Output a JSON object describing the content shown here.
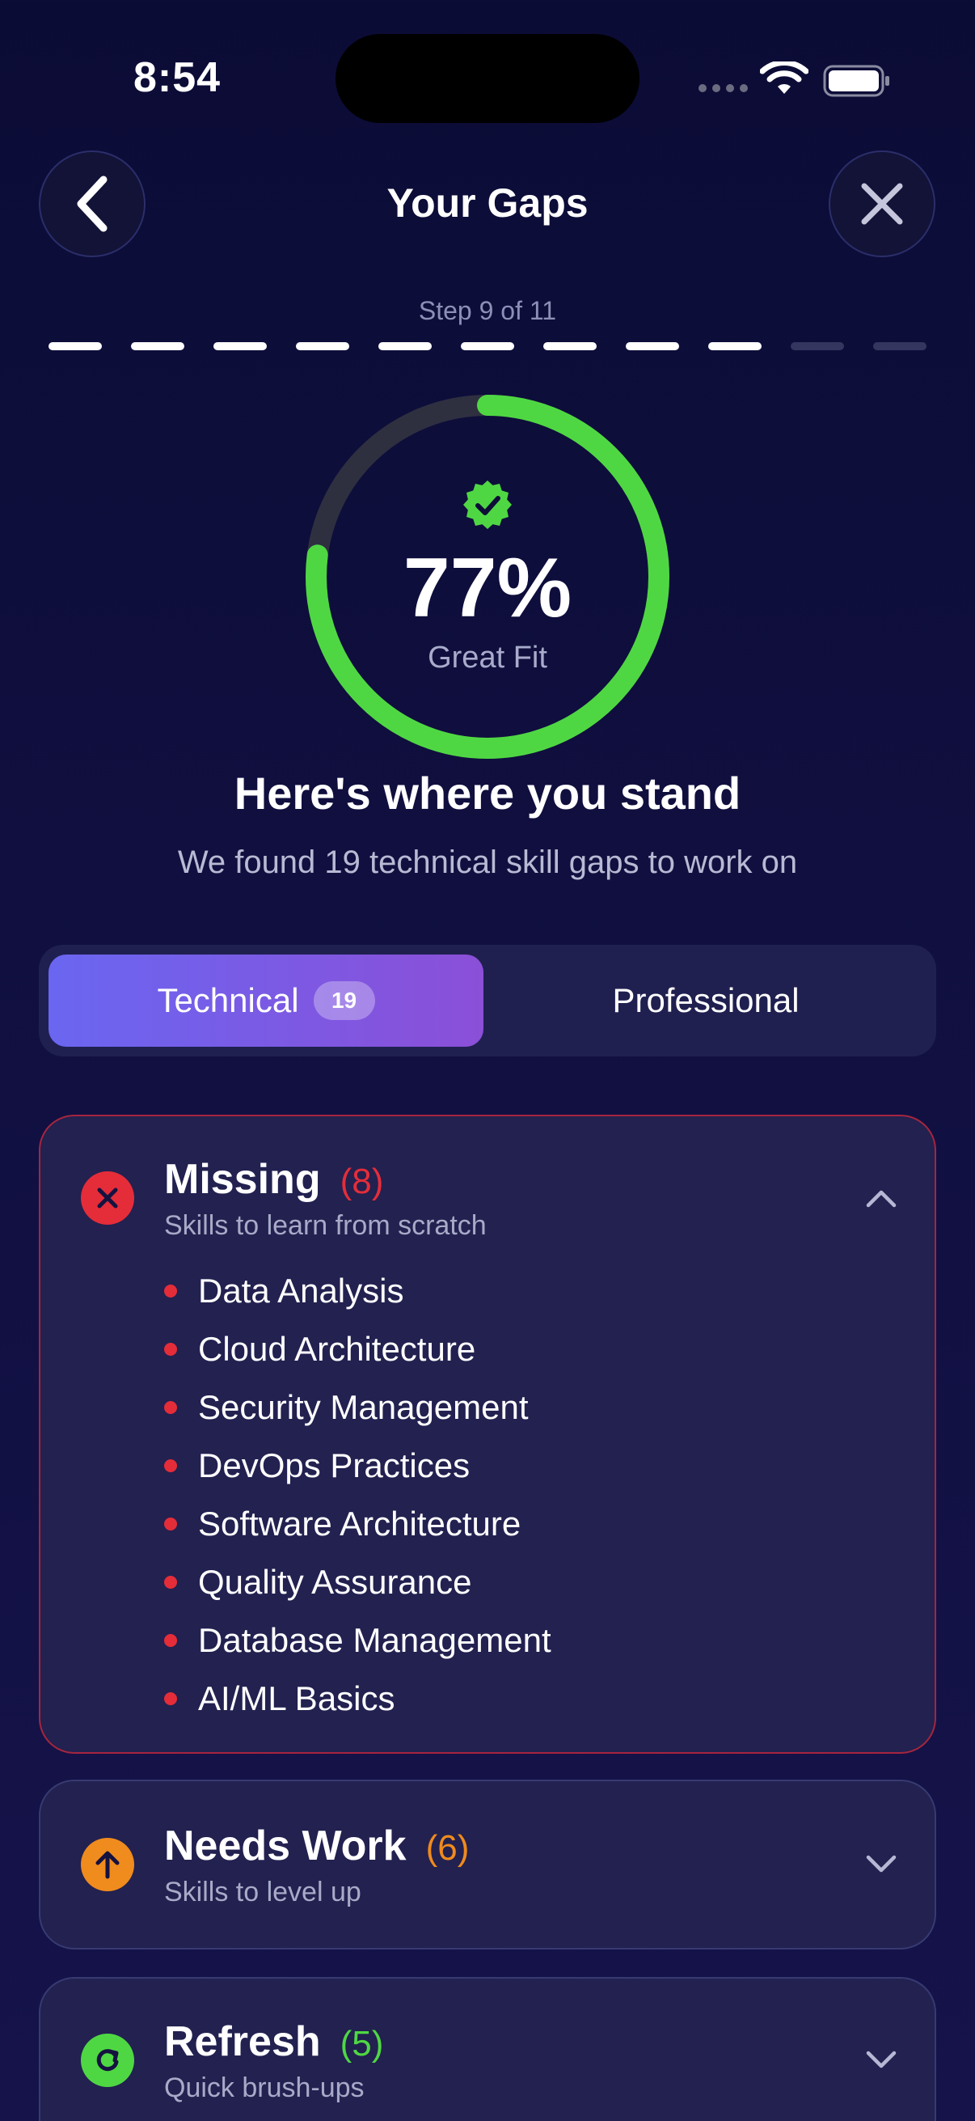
{
  "status_bar": {
    "time": "8:54"
  },
  "header": {
    "title": "Your Gaps"
  },
  "progress": {
    "label": "Step 9 of 11",
    "current_step": 9,
    "total_steps": 11
  },
  "score": {
    "percent": 77,
    "percent_text": "77%",
    "label": "Great Fit",
    "color": "#4fd743"
  },
  "summary": {
    "headline": "Here's where you stand",
    "subhead": "We found 19 technical skill gaps to work on"
  },
  "tabs": [
    {
      "label": "Technical",
      "badge": "19",
      "selected": true
    },
    {
      "label": "Professional",
      "selected": false
    }
  ],
  "groups": {
    "missing": {
      "title": "Missing",
      "count": "(8)",
      "subtitle": "Skills to learn from scratch",
      "color": "#e42d39",
      "icon": "x-icon",
      "expanded": true,
      "items": [
        "Data Analysis",
        "Cloud Architecture",
        "Security Management",
        "DevOps Practices",
        "Software Architecture",
        "Quality Assurance",
        "Database Management",
        "AI/ML Basics"
      ]
    },
    "needs_work": {
      "title": "Needs Work",
      "count": "(6)",
      "subtitle": "Skills to level up",
      "color": "#f08b1d",
      "icon": "arrow-up-icon",
      "expanded": false
    },
    "refresh": {
      "title": "Refresh",
      "count": "(5)",
      "subtitle": "Quick brush-ups",
      "color": "#4fd743",
      "icon": "refresh-icon",
      "expanded": false
    }
  }
}
